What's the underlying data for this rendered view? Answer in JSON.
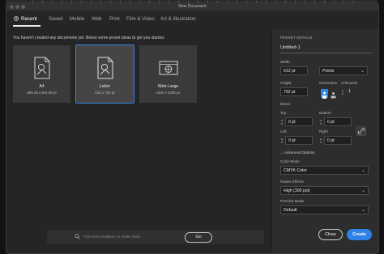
{
  "window": {
    "title": "New Document"
  },
  "tabs": [
    {
      "label": "Recent",
      "active": true
    },
    {
      "label": "Saved"
    },
    {
      "label": "Mobile"
    },
    {
      "label": "Web"
    },
    {
      "label": "Print"
    },
    {
      "label": "Film & Video"
    },
    {
      "label": "Art & Illustration"
    }
  ],
  "main": {
    "hint": "You haven't created any documents yet. Below some preset ideas to get you started.",
    "presets": [
      {
        "name": "A4",
        "dims": "595.28 x 841.89 pt",
        "icon": "document-icon",
        "selected": false
      },
      {
        "name": "Letter",
        "dims": "612 x 792 pt",
        "icon": "document-icon",
        "selected": true
      },
      {
        "name": "Web-Large",
        "dims": "1920 x 1080 px",
        "icon": "web-icon",
        "selected": false
      }
    ],
    "stock": {
      "placeholder": "Find more templates on Adobe Stock",
      "go_label": "Go"
    }
  },
  "details": {
    "header": "PRESET DETAILS",
    "name": "Untitled-1",
    "width_label": "Width",
    "width": "612 pt",
    "units": "Points",
    "height_label": "Height",
    "height": "792 pt",
    "orientation_label": "Orientation",
    "artboards_label": "Artboards",
    "artboards": "1",
    "bleed_label": "Bleed",
    "top_label": "Top",
    "top": "0 pt",
    "bottom_label": "Bottom",
    "bottom": "0 pt",
    "left_label": "Left",
    "left": "0 pt",
    "right_label": "Right",
    "right": "0 pt",
    "advanced_label": "Advanced Options",
    "color_mode_label": "Color Mode",
    "color_mode": "CMYK Color",
    "raster_label": "Raster Effects",
    "raster": "High (300 ppi)",
    "preview_label": "Preview Mode",
    "preview": "Default"
  },
  "buttons": {
    "close": "Close",
    "create": "Create"
  },
  "colors": {
    "accent": "#2f80e6",
    "selection": "#2e86e3",
    "panel": "#2d2d2d",
    "background": "#252525"
  }
}
